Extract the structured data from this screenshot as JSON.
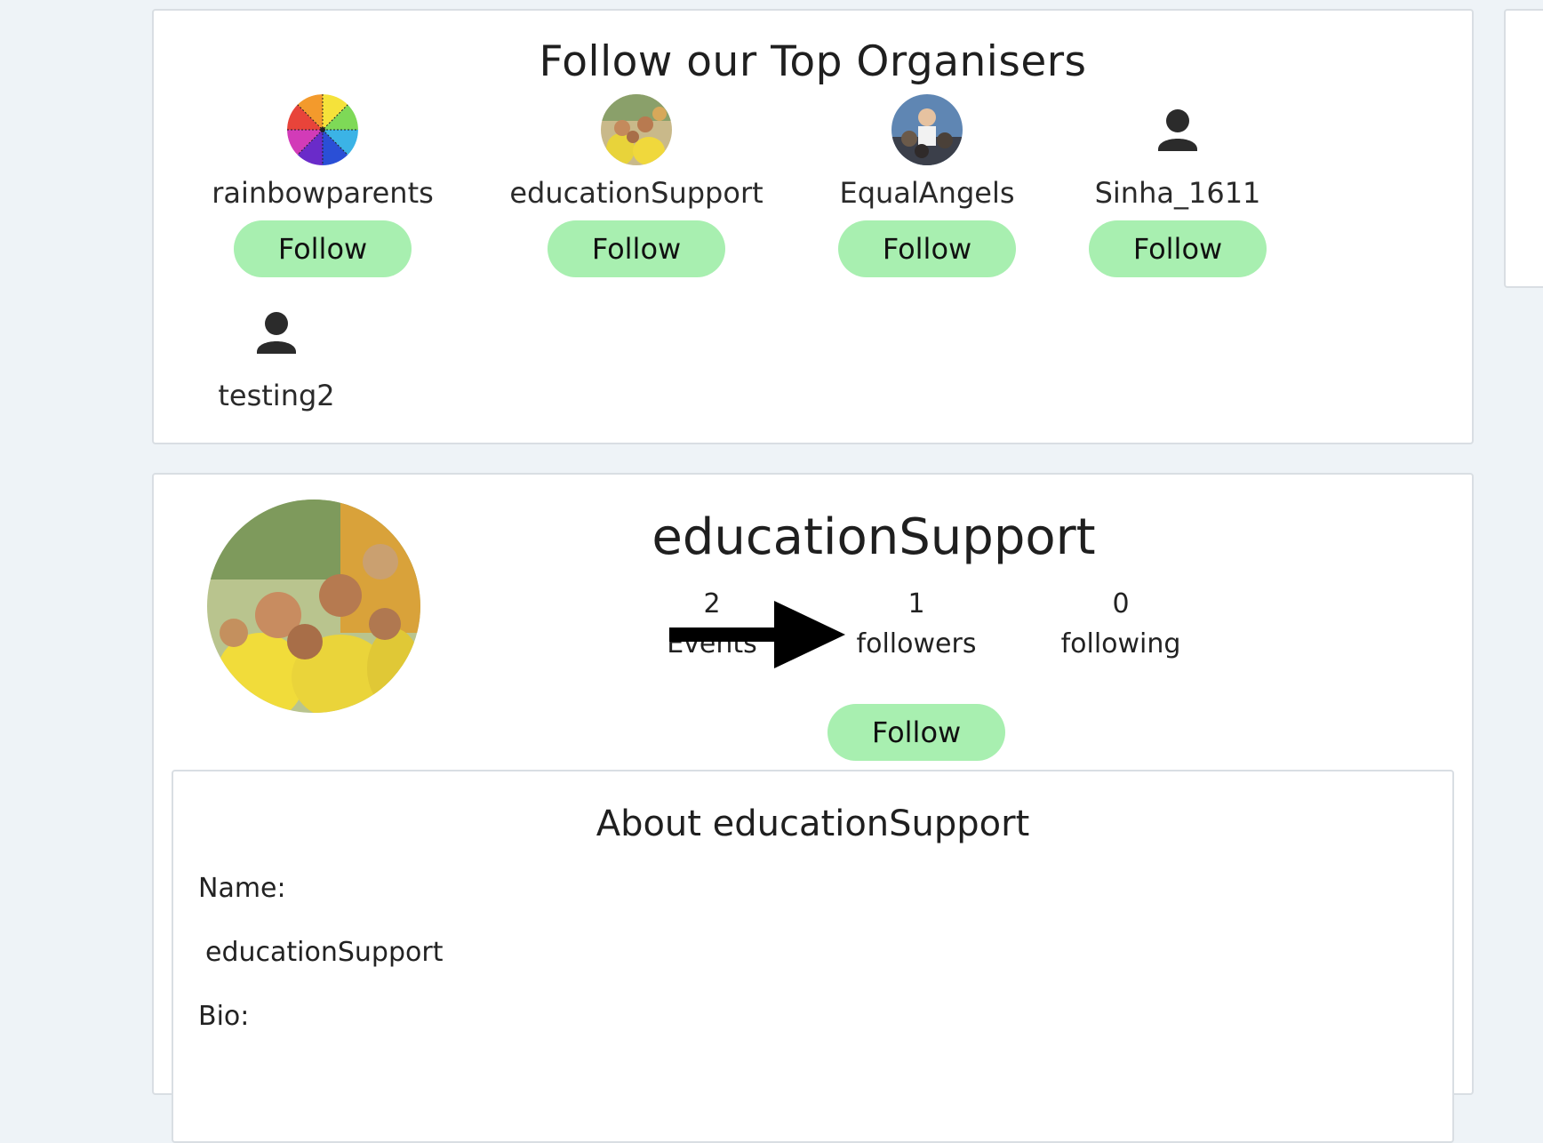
{
  "top_organisers": {
    "title": "Follow our Top Organisers",
    "follow_label": "Follow",
    "organisers": [
      {
        "name": "rainbowparents",
        "avatar": "rainbow-wheel-icon"
      },
      {
        "name": "educationSupport",
        "avatar": "group-photo"
      },
      {
        "name": "EqualAngels",
        "avatar": "crowd-photo"
      },
      {
        "name": "Sinha_1611",
        "avatar": "user-icon"
      },
      {
        "name": "testing2",
        "avatar": "user-icon"
      }
    ]
  },
  "profile": {
    "name": "educationSupport",
    "stats": {
      "events_count": "2",
      "events_label": "Events",
      "followers_count": "1",
      "followers_label": "followers",
      "following_count": "0",
      "following_label": "following"
    },
    "follow_label": "Follow"
  },
  "about": {
    "title": "About educationSupport",
    "name_label": "Name:",
    "name_value": "educationSupport",
    "bio_label": "Bio:"
  },
  "colors": {
    "follow_button": "#a8efb0",
    "page_background": "#eef3f7",
    "card_background": "#ffffff",
    "annotation_arrow": "#000000"
  }
}
